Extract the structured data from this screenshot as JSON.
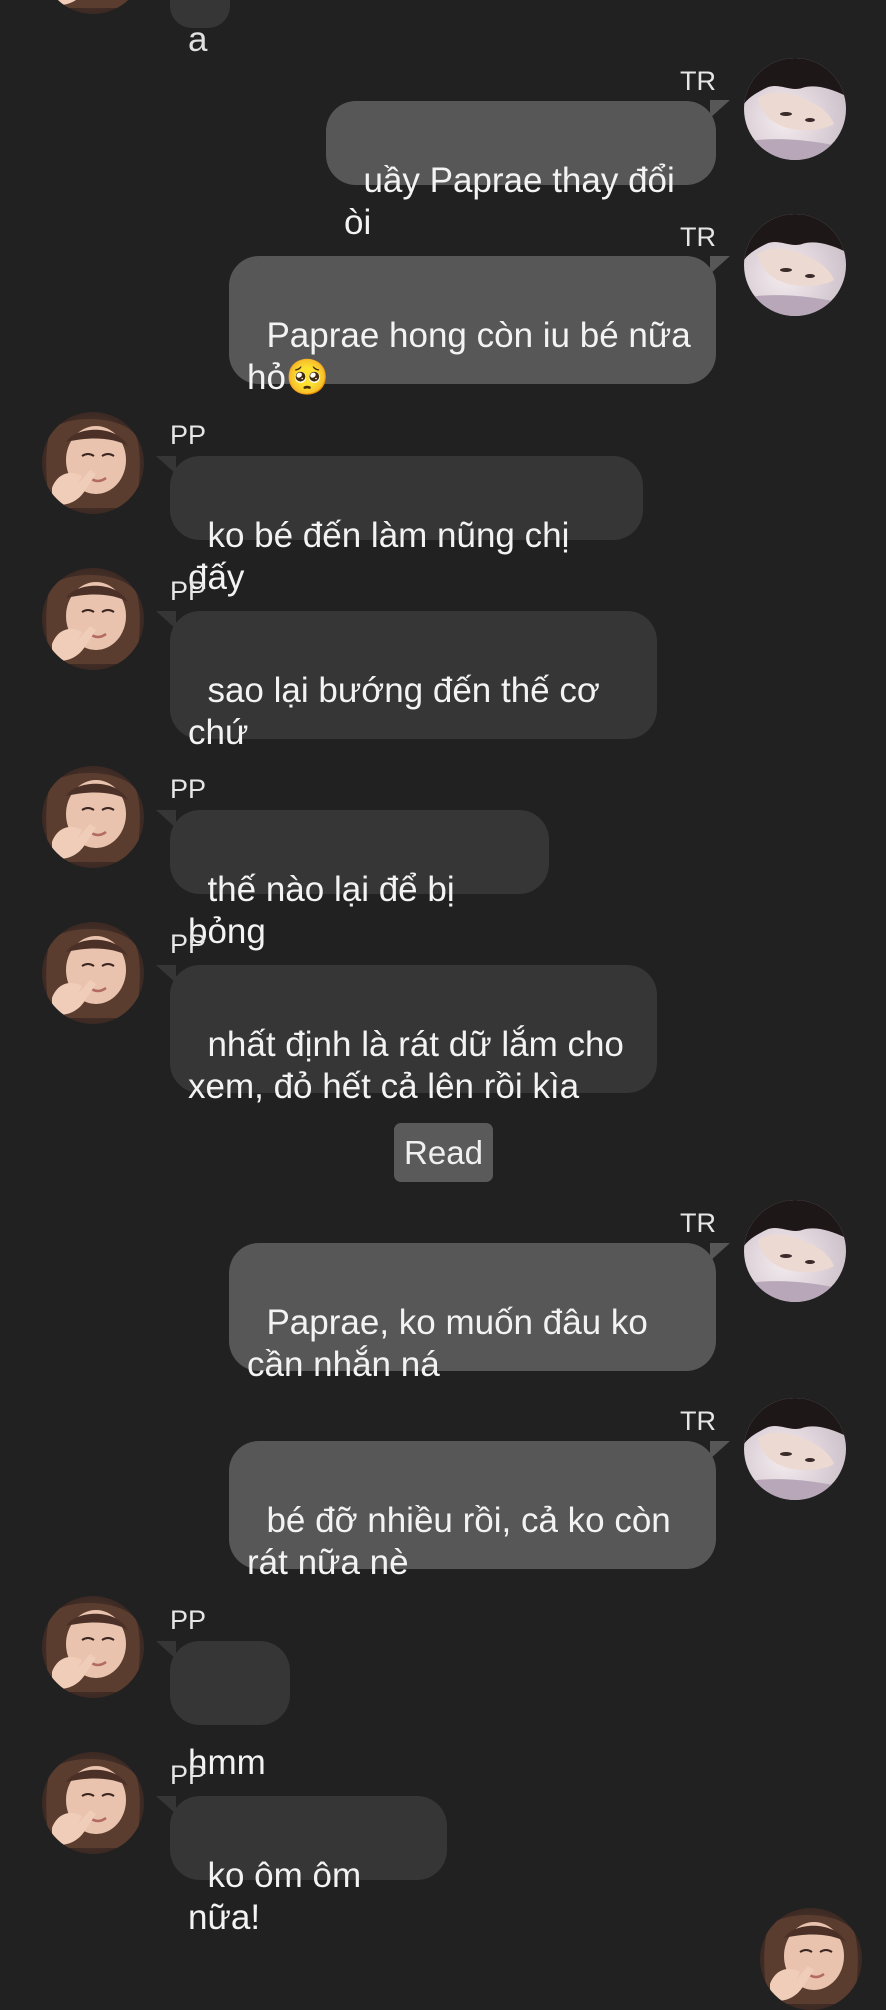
{
  "status": {
    "read_label": "Read"
  },
  "messages": [
    {
      "sender": "TR",
      "direction": "outgoing",
      "text": "uầy Paprae thay đổi òi"
    },
    {
      "sender": "TR",
      "direction": "outgoing",
      "text": "Paprae hong còn iu bé nữa\nhỏ🥺"
    },
    {
      "sender": "PP",
      "direction": "incoming",
      "text": "ko bé đến làm nũng chị đấy"
    },
    {
      "sender": "PP",
      "direction": "incoming",
      "text": "sao lại bướng đến thế cơ\nchứ"
    },
    {
      "sender": "PP",
      "direction": "incoming",
      "text": "thế nào lại để bị bỏng"
    },
    {
      "sender": "PP",
      "direction": "incoming",
      "text": "nhất định là rát dữ lắm cho\nxem, đỏ hết cả lên rồi kìa"
    },
    {
      "sender": "TR",
      "direction": "outgoing",
      "text": "Paprae, ko muốn đâu ko\ncần nhắn ná"
    },
    {
      "sender": "TR",
      "direction": "outgoing",
      "text": "bé đỡ nhiều rồi, cả ko còn\nrát nữa nè"
    },
    {
      "sender": "PP",
      "direction": "incoming",
      "text": "hmm"
    },
    {
      "sender": "PP",
      "direction": "incoming",
      "text": "ko ôm ôm nữa!"
    }
  ],
  "top_partial_bubble": {
    "text": "a"
  },
  "colors": {
    "background": "#212121",
    "incoming_bubble": "#363636",
    "outgoing_bubble": "#575757",
    "text": "#f3f3f3"
  },
  "icons": {
    "tr_avatar": "avatar-tr-photo",
    "pp_avatar": "avatar-pp-photo"
  }
}
